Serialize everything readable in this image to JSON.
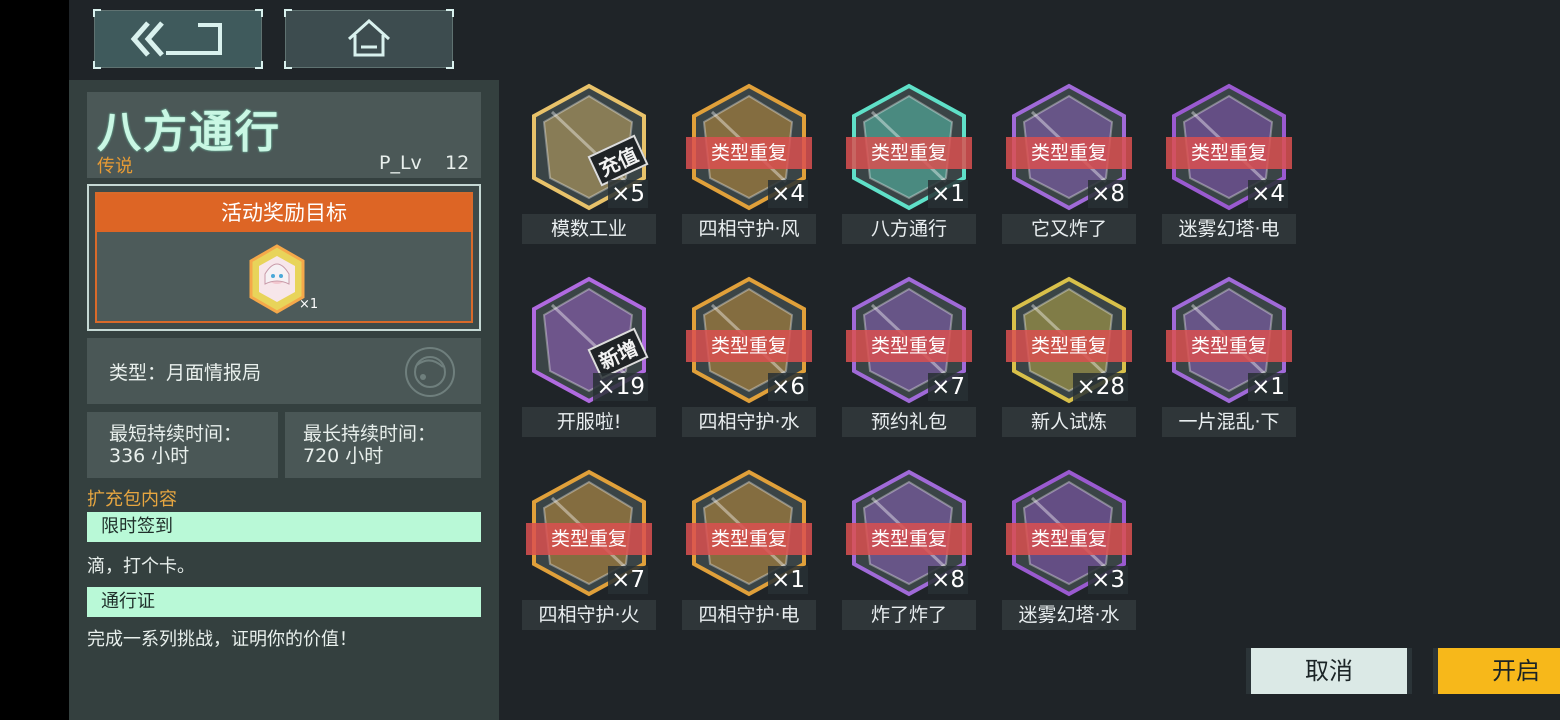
{
  "nav": {
    "back_icon": "double-chevron-back-icon",
    "home_icon": "home-icon"
  },
  "pack": {
    "title": "八方通行",
    "rarity": "传说",
    "plv_label": "P_Lv",
    "plv_value": "12"
  },
  "reward": {
    "header": "活动奖励目标",
    "count": "×1"
  },
  "type_label": "类型：月面情报局",
  "duration": {
    "min_label": "最短持续时间：",
    "min_value": "336 小时",
    "max_label": "最长持续时间：",
    "max_value": "720 小时"
  },
  "contents": {
    "heading": "扩充包内容",
    "items": [
      {
        "title": "限时签到",
        "desc": "滴，打个卡。"
      },
      {
        "title": "通行证",
        "desc": "完成一系列挑战，证明你的价值！"
      }
    ]
  },
  "cards": [
    {
      "name": "模数工业",
      "qty": "×5",
      "dup": "",
      "tag": "充值",
      "color": "#e8c26a"
    },
    {
      "name": "四相守护·风",
      "qty": "×4",
      "dup": "类型重复",
      "tag": "",
      "color": "#e0a03a"
    },
    {
      "name": "八方通行",
      "qty": "×1",
      "dup": "类型重复",
      "tag": "",
      "color": "#5fe0c8"
    },
    {
      "name": "它又炸了",
      "qty": "×8",
      "dup": "类型重复",
      "tag": "",
      "color": "#a06ad8"
    },
    {
      "name": "迷雾幻塔·电",
      "qty": "×4",
      "dup": "类型重复",
      "tag": "",
      "color": "#9a5ad0"
    },
    {
      "name": "开服啦!",
      "qty": "×19",
      "dup": "",
      "tag": "新增",
      "color": "#b06ae0"
    },
    {
      "name": "四相守护·水",
      "qty": "×6",
      "dup": "类型重复",
      "tag": "",
      "color": "#e0a03a"
    },
    {
      "name": "预约礼包",
      "qty": "×7",
      "dup": "类型重复",
      "tag": "",
      "color": "#a06ad8"
    },
    {
      "name": "新人试炼",
      "qty": "×28",
      "dup": "类型重复",
      "tag": "",
      "color": "#d8c04a"
    },
    {
      "name": "一片混乱·下",
      "qty": "×1",
      "dup": "类型重复",
      "tag": "",
      "color": "#a06ad8"
    },
    {
      "name": "四相守护·火",
      "qty": "×7",
      "dup": "类型重复",
      "tag": "",
      "color": "#e0a03a"
    },
    {
      "name": "四相守护·电",
      "qty": "×1",
      "dup": "类型重复",
      "tag": "",
      "color": "#e0a03a"
    },
    {
      "name": "炸了炸了",
      "qty": "×8",
      "dup": "类型重复",
      "tag": "",
      "color": "#a06ad8"
    },
    {
      "name": "迷雾幻塔·水",
      "qty": "×3",
      "dup": "类型重复",
      "tag": "",
      "color": "#9a5ad0"
    }
  ],
  "actions": {
    "cancel": "取消",
    "open": "开启"
  }
}
